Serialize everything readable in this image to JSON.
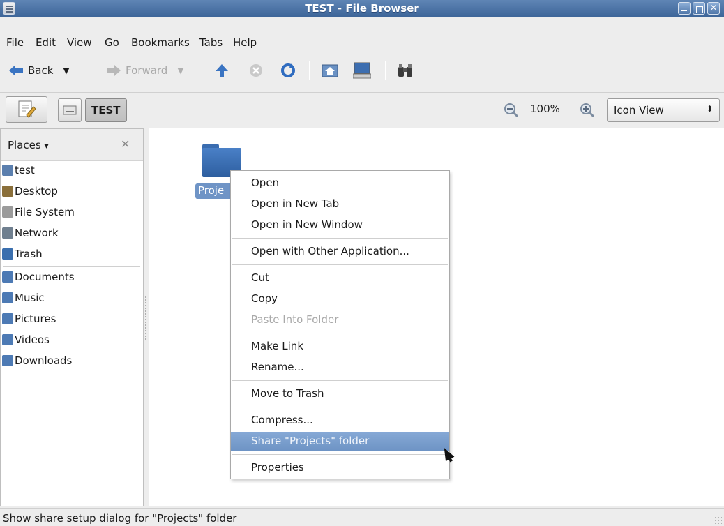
{
  "window": {
    "title": "TEST - File Browser"
  },
  "menubar": [
    "File",
    "Edit",
    "View",
    "Go",
    "Bookmarks",
    "Tabs",
    "Help"
  ],
  "toolbar": {
    "back_label": "Back",
    "forward_label": "Forward"
  },
  "location": {
    "current_button": "TEST",
    "zoom": "100%",
    "view_mode": "Icon View"
  },
  "sidebar": {
    "header": "Places",
    "places": [
      {
        "label": "test",
        "icon": "home-folder-icon",
        "color": "#5b7fae"
      },
      {
        "label": "Desktop",
        "icon": "desktop-icon",
        "color": "#8a6f3a"
      },
      {
        "label": "File System",
        "icon": "drive-icon",
        "color": "#9b9b9b"
      },
      {
        "label": "Network",
        "icon": "network-icon",
        "color": "#6f7f8f"
      },
      {
        "label": "Trash",
        "icon": "trash-icon",
        "color": "#3b6fae"
      }
    ],
    "bookmarks": [
      {
        "label": "Documents",
        "icon": "documents-folder-icon",
        "color": "#4d7ab4"
      },
      {
        "label": "Music",
        "icon": "music-folder-icon",
        "color": "#4d7ab4"
      },
      {
        "label": "Pictures",
        "icon": "pictures-folder-icon",
        "color": "#4d7ab4"
      },
      {
        "label": "Videos",
        "icon": "videos-folder-icon",
        "color": "#4d7ab4"
      },
      {
        "label": "Downloads",
        "icon": "downloads-folder-icon",
        "color": "#4d7ab4"
      }
    ]
  },
  "folder": {
    "name": "Proje"
  },
  "context_menu": [
    {
      "label": "Open",
      "state": "normal"
    },
    {
      "label": "Open in New Tab",
      "state": "normal"
    },
    {
      "label": "Open in New Window",
      "state": "normal"
    },
    {
      "label": "Open with Other Application...",
      "state": "normal"
    },
    {
      "label": "Cut",
      "state": "normal"
    },
    {
      "label": "Copy",
      "state": "normal"
    },
    {
      "label": "Paste Into Folder",
      "state": "disabled"
    },
    {
      "label": "Make Link",
      "state": "normal"
    },
    {
      "label": "Rename...",
      "state": "normal"
    },
    {
      "label": "Move to Trash",
      "state": "normal"
    },
    {
      "label": "Compress...",
      "state": "normal"
    },
    {
      "label": "Share \"Projects\" folder",
      "state": "highlighted"
    },
    {
      "label": "Properties",
      "state": "normal"
    }
  ],
  "status": {
    "text": "Show share setup dialog for \"Projects\" folder"
  },
  "colors": {
    "titlebar": "#4a72a6",
    "highlight": "#7a9ecf",
    "folder": "#3a6db0"
  }
}
